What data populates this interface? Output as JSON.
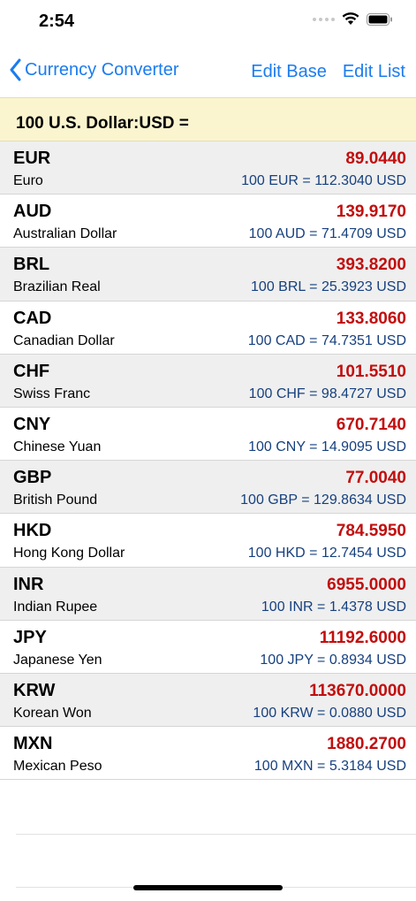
{
  "status_bar": {
    "time": "2:54"
  },
  "nav": {
    "back_label": "Currency Converter",
    "edit_base_label": "Edit Base",
    "edit_list_label": "Edit List"
  },
  "base": {
    "text": "100 U.S. Dollar:USD ="
  },
  "colors": {
    "accent": "#1a7cf0",
    "value_red": "#c20e0e",
    "inverse_blue": "#16407e",
    "header_bg": "#fbf5cf",
    "row_shade": "#efefef"
  },
  "rates": [
    {
      "code": "EUR",
      "name": "Euro",
      "value": "89.0440",
      "inverse": "100 EUR = 112.3040 USD"
    },
    {
      "code": "AUD",
      "name": "Australian Dollar",
      "value": "139.9170",
      "inverse": "100 AUD = 71.4709 USD"
    },
    {
      "code": "BRL",
      "name": "Brazilian Real",
      "value": "393.8200",
      "inverse": "100 BRL = 25.3923 USD"
    },
    {
      "code": "CAD",
      "name": "Canadian Dollar",
      "value": "133.8060",
      "inverse": "100 CAD = 74.7351 USD"
    },
    {
      "code": "CHF",
      "name": "Swiss Franc",
      "value": "101.5510",
      "inverse": "100 CHF = 98.4727 USD"
    },
    {
      "code": "CNY",
      "name": "Chinese Yuan",
      "value": "670.7140",
      "inverse": "100 CNY = 14.9095 USD"
    },
    {
      "code": "GBP",
      "name": "British Pound",
      "value": "77.0040",
      "inverse": "100 GBP = 129.8634 USD"
    },
    {
      "code": "HKD",
      "name": "Hong Kong Dollar",
      "value": "784.5950",
      "inverse": "100 HKD = 12.7454 USD"
    },
    {
      "code": "INR",
      "name": "Indian Rupee",
      "value": "6955.0000",
      "inverse": "100 INR = 1.4378 USD"
    },
    {
      "code": "JPY",
      "name": "Japanese Yen",
      "value": "11192.6000",
      "inverse": "100 JPY = 0.8934 USD"
    },
    {
      "code": "KRW",
      "name": "Korean Won",
      "value": "113670.0000",
      "inverse": "100 KRW = 0.0880 USD"
    },
    {
      "code": "MXN",
      "name": "Mexican Peso",
      "value": "1880.2700",
      "inverse": "100 MXN = 5.3184 USD"
    }
  ]
}
